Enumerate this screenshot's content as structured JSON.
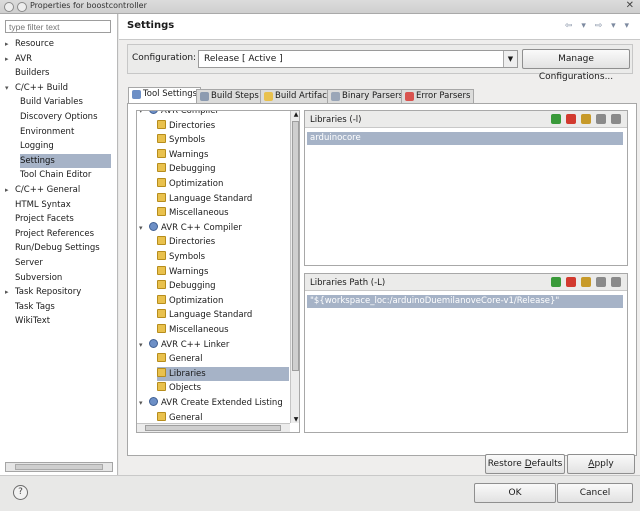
{
  "window": {
    "title": "Properties for boostcontroller",
    "close_glyph": "✕"
  },
  "left": {
    "filter_placeholder": "type filter text",
    "items": [
      {
        "label": "Resource",
        "arrow": "▸"
      },
      {
        "label": "AVR",
        "arrow": "▸"
      },
      {
        "label": "Builders",
        "arrow": ""
      },
      {
        "label": "C/C++ Build",
        "arrow": "▾"
      },
      {
        "label": "Build Variables",
        "arrow": ""
      },
      {
        "label": "Discovery Options",
        "arrow": ""
      },
      {
        "label": "Environment",
        "arrow": ""
      },
      {
        "label": "Logging",
        "arrow": ""
      },
      {
        "label": "Settings",
        "arrow": ""
      },
      {
        "label": "Tool Chain Editor",
        "arrow": ""
      },
      {
        "label": "C/C++ General",
        "arrow": "▸"
      },
      {
        "label": "HTML Syntax",
        "arrow": ""
      },
      {
        "label": "Project Facets",
        "arrow": ""
      },
      {
        "label": "Project References",
        "arrow": ""
      },
      {
        "label": "Run/Debug Settings",
        "arrow": ""
      },
      {
        "label": "Server",
        "arrow": ""
      },
      {
        "label": "Subversion",
        "arrow": ""
      },
      {
        "label": "Task Repository",
        "arrow": "▸"
      },
      {
        "label": "Task Tags",
        "arrow": ""
      },
      {
        "label": "WikiText",
        "arrow": ""
      }
    ]
  },
  "settings": {
    "title": "Settings",
    "nav_glyphs": "⇦ ▾ ⇨ ▾ ▾",
    "config_label": "Configuration:",
    "config_value": "Release  [ Active ]",
    "manage_label": "Manage Configurations..."
  },
  "tabs": [
    {
      "label": "Tool Settings",
      "color": "#6d8fc6"
    },
    {
      "label": "Build Steps",
      "color": "#8c9bb1"
    },
    {
      "label": "Build Artifact",
      "color": "#e9c14d"
    },
    {
      "label": "Binary Parsers",
      "color": "#9aa6b8"
    },
    {
      "label": "Error Parsers",
      "color": "#d9534f"
    }
  ],
  "tooltree": {
    "items": [
      {
        "label": "AVR Compiler",
        "type": "gear",
        "arrow": "▾"
      },
      {
        "label": "Directories",
        "type": "folder"
      },
      {
        "label": "Symbols",
        "type": "folder"
      },
      {
        "label": "Warnings",
        "type": "folder"
      },
      {
        "label": "Debugging",
        "type": "folder"
      },
      {
        "label": "Optimization",
        "type": "folder"
      },
      {
        "label": "Language Standard",
        "type": "folder"
      },
      {
        "label": "Miscellaneous",
        "type": "folder"
      },
      {
        "label": "AVR C++ Compiler",
        "type": "gear",
        "arrow": "▾"
      },
      {
        "label": "Directories",
        "type": "folder"
      },
      {
        "label": "Symbols",
        "type": "folder"
      },
      {
        "label": "Warnings",
        "type": "folder"
      },
      {
        "label": "Debugging",
        "type": "folder"
      },
      {
        "label": "Optimization",
        "type": "folder"
      },
      {
        "label": "Language Standard",
        "type": "folder"
      },
      {
        "label": "Miscellaneous",
        "type": "folder"
      },
      {
        "label": "AVR C++ Linker",
        "type": "gear",
        "arrow": "▾"
      },
      {
        "label": "General",
        "type": "folder"
      },
      {
        "label": "Libraries",
        "type": "folder"
      },
      {
        "label": "Objects",
        "type": "folder"
      },
      {
        "label": "AVR Create Extended Listing",
        "type": "gear",
        "arrow": "▾"
      },
      {
        "label": "General",
        "type": "folder"
      }
    ]
  },
  "libraries": {
    "title": "Libraries (-l)",
    "entries": [
      "arduinocore"
    ]
  },
  "library_paths": {
    "title": "Libraries Path (-L)",
    "entries": [
      "\"${workspace_loc:/arduinoDuemilanoveCore-v1/Release}\""
    ]
  },
  "buttons": {
    "restore_prefix": "Restore ",
    "restore_mnemonic": "D",
    "restore_suffix": "efaults",
    "apply_mnemonic": "A",
    "apply_suffix": "pply",
    "ok": "OK",
    "cancel": "Cancel",
    "help_glyph": "?"
  },
  "icon_colors": {
    "add": "#3a9a3a",
    "delete": "#d23a2f",
    "edit": "#c79a2a",
    "up": "#8a8a8a",
    "down": "#8a8a8a"
  }
}
